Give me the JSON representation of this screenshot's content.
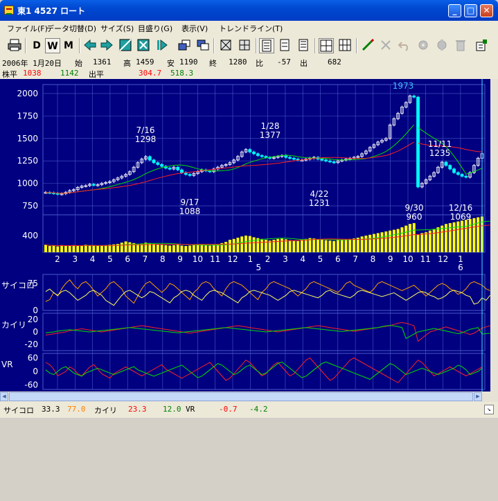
{
  "window": {
    "title": "東1 4527 ロート",
    "min": "_",
    "max": "□",
    "close": "✕"
  },
  "menu": [
    "ファイル(F)",
    "データ切替(D)",
    "サイズ(S)",
    "目盛り(G)",
    "表示(V)",
    "トレンドライン(T)"
  ],
  "toolbar": {
    "daily": "D",
    "weekly": "W",
    "monthly": "M"
  },
  "info": {
    "date": "2006年 1月20日",
    "open_label": "始",
    "open": "1361",
    "high_label": "高",
    "high": "1459",
    "low_label": "安",
    "low": "1190",
    "close_label": "終",
    "close": "1280",
    "change_label": "比",
    "change": "-57",
    "volume_label": "出",
    "volume": "682",
    "avg_label": "株平",
    "avg1": "1038",
    "avg2": "1142",
    "vol_avg_label": "出平",
    "vol_avg1": "304.7",
    "vol_avg2": "518.3"
  },
  "status": {
    "psy_label": "サイコロ",
    "psy1": "33.3",
    "psy2": "77.0",
    "kairi_label": "カイリ",
    "kairi1": "23.3",
    "kairi2": "12.0",
    "vr_label": "VR",
    "vr1": "-0.7",
    "vr2": "-4.2"
  },
  "colors": {
    "background": "#000080",
    "grid": "#4a58c8",
    "up": "#ffffff",
    "down": "#00ffff",
    "ma_short": "#00e000",
    "ma_long": "#ff2020",
    "volume": "#ffff00",
    "psy_a": "#ffa000",
    "psy_b": "#ffff60"
  },
  "chart_data": {
    "type": "line",
    "price_axis": [
      2000,
      1750,
      1500,
      1250,
      1000,
      750
    ],
    "volume_axis": [
      400
    ],
    "month_ticks": [
      "2",
      "3",
      "4",
      "5",
      "6",
      "7",
      "8",
      "9",
      "10",
      "11",
      "12",
      "1",
      "2",
      "3",
      "4",
      "5",
      "6",
      "7",
      "8",
      "9",
      "10",
      "11",
      "12",
      "1"
    ],
    "year_ticks": [
      "5",
      "6"
    ],
    "panels": [
      {
        "name": "サイコロ",
        "ticks": [
          "75",
          "0"
        ]
      },
      {
        "name": "カイリ",
        "ticks": [
          "20",
          "0",
          "-20"
        ]
      },
      {
        "name": "VR",
        "ticks": [
          "60",
          "0",
          "-60"
        ]
      }
    ],
    "annotations": [
      {
        "date": "7/16",
        "value": "1298"
      },
      {
        "date": "9/17",
        "value": "1088"
      },
      {
        "date": "1/28",
        "value": "1377"
      },
      {
        "date": "4/22",
        "value": "1231"
      },
      {
        "date": "",
        "value": "1973"
      },
      {
        "date": "11/11",
        "value": "1235"
      },
      {
        "date": "9/30",
        "value": "960"
      },
      {
        "date": "12/16",
        "value": "1069"
      }
    ],
    "weekly_close": [
      900,
      895,
      890,
      880,
      885,
      900,
      920,
      930,
      955,
      970,
      975,
      990,
      980,
      985,
      1000,
      1010,
      1020,
      1040,
      1060,
      1080,
      1100,
      1130,
      1180,
      1230,
      1270,
      1298,
      1260,
      1230,
      1210,
      1190,
      1170,
      1160,
      1180,
      1150,
      1120,
      1100,
      1088,
      1110,
      1130,
      1150,
      1140,
      1130,
      1160,
      1180,
      1200,
      1210,
      1230,
      1260,
      1300,
      1350,
      1377,
      1350,
      1330,
      1310,
      1300,
      1290,
      1280,
      1290,
      1300,
      1310,
      1290,
      1280,
      1270,
      1260,
      1260,
      1270,
      1280,
      1290,
      1270,
      1260,
      1250,
      1240,
      1231,
      1250,
      1260,
      1270,
      1280,
      1290,
      1300,
      1330,
      1360,
      1400,
      1430,
      1460,
      1480,
      1500,
      1650,
      1720,
      1780,
      1850,
      1900,
      1973,
      1960,
      960,
      1000,
      1040,
      1080,
      1120,
      1180,
      1235,
      1200,
      1160,
      1120,
      1100,
      1080,
      1069,
      1120,
      1200,
      1280,
      1330
    ],
    "weekly_volume": [
      180,
      150,
      160,
      140,
      170,
      150,
      160,
      170,
      150,
      160,
      180,
      170,
      160,
      150,
      160,
      170,
      180,
      190,
      200,
      230,
      260,
      240,
      220,
      200,
      210,
      230,
      220,
      200,
      190,
      180,
      170,
      160,
      170,
      180,
      160,
      150,
      160,
      170,
      180,
      190,
      170,
      160,
      180,
      200,
      220,
      250,
      300,
      320,
      350,
      380,
      400,
      390,
      360,
      340,
      320,
      300,
      280,
      300,
      320,
      330,
      310,
      290,
      280,
      270,
      300,
      320,
      340,
      330,
      310,
      300,
      290,
      280,
      270,
      290,
      300,
      310,
      320,
      330,
      350,
      380,
      400,
      420,
      440,
      460,
      480,
      500,
      520,
      540,
      560,
      600,
      640,
      680,
      700,
      420,
      460,
      480,
      520,
      560,
      600,
      640,
      680,
      700,
      720,
      740,
      760,
      780,
      800,
      820,
      840,
      860,
      700,
      682
    ],
    "psy": [
      25,
      30,
      50,
      40,
      60,
      75,
      85,
      70,
      60,
      75,
      80,
      70,
      55,
      40,
      50,
      60,
      75,
      80,
      70,
      60,
      40,
      30,
      20,
      40,
      60,
      75,
      80,
      70,
      60,
      50,
      60,
      75,
      70,
      60,
      50,
      40,
      30,
      50,
      60,
      75,
      80,
      75,
      60,
      50,
      40,
      60,
      75,
      80,
      75,
      70,
      60,
      50,
      40,
      30,
      50,
      60,
      75,
      80,
      75,
      70,
      65,
      60,
      50,
      40,
      50,
      60,
      75,
      80,
      75,
      70,
      65,
      60,
      55,
      50,
      60,
      75,
      80,
      70,
      65,
      60,
      55,
      50,
      60,
      75,
      80,
      75,
      70,
      65,
      60,
      55,
      60,
      65,
      70,
      60,
      50,
      40,
      50,
      60,
      70,
      75,
      70,
      60,
      55,
      45,
      50,
      60,
      75,
      80,
      75,
      70,
      60,
      55
    ],
    "kairi": [
      -5,
      -4,
      -3,
      -2,
      -1,
      0,
      2,
      3,
      4,
      5,
      4,
      3,
      2,
      1,
      0,
      1,
      2,
      3,
      4,
      5,
      6,
      7,
      8,
      9,
      10,
      9,
      8,
      7,
      6,
      5,
      4,
      3,
      2,
      1,
      0,
      -1,
      -2,
      -1,
      0,
      1,
      2,
      3,
      4,
      5,
      6,
      7,
      8,
      9,
      10,
      9,
      8,
      7,
      6,
      5,
      4,
      3,
      2,
      1,
      0,
      1,
      2,
      3,
      4,
      5,
      6,
      7,
      8,
      9,
      10,
      9,
      8,
      7,
      6,
      5,
      4,
      3,
      2,
      1,
      2,
      3,
      4,
      5,
      6,
      7,
      8,
      9,
      10,
      12,
      14,
      15,
      14,
      12,
      10,
      -15,
      -10,
      -5,
      0,
      2,
      4,
      6,
      8,
      6,
      4,
      2,
      0,
      -2,
      -4,
      -2,
      2,
      6,
      8,
      10
    ],
    "vr": [
      40,
      30,
      10,
      -20,
      -10,
      0,
      20,
      10,
      -10,
      -20,
      0,
      20,
      30,
      10,
      -10,
      -20,
      -30,
      -10,
      0,
      10,
      20,
      10,
      0,
      -10,
      -20,
      -10,
      0,
      10,
      20,
      30,
      10,
      0,
      -10,
      -20,
      -30,
      -20,
      -10,
      0,
      10,
      20,
      30,
      40,
      20,
      0,
      -20,
      -40,
      -30,
      -10,
      10,
      30,
      50,
      40,
      20,
      0,
      -20,
      -10,
      10,
      30,
      40,
      20,
      0,
      -20,
      -10,
      10,
      30,
      50,
      60,
      40,
      20,
      0,
      -20,
      -40,
      -30,
      -10,
      10,
      30,
      50,
      60,
      50,
      40,
      30,
      20,
      10,
      0,
      -10,
      -20,
      -30,
      -40,
      -50,
      -30,
      -10,
      10,
      30,
      50,
      40,
      20,
      0,
      -20,
      -10,
      0,
      10,
      20,
      10,
      0,
      -10,
      -20,
      -10,
      0,
      10,
      20
    ]
  }
}
